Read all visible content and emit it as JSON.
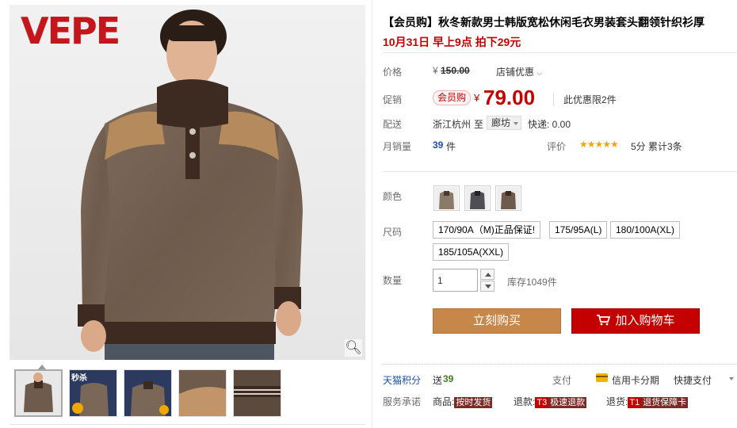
{
  "gallery": {
    "brand_logo": "VEPE",
    "zoom_icon": "magnifier-icon",
    "thumb2_badge": "秒杀"
  },
  "product": {
    "title": "【会员购】秋冬新款男士韩版宽松休闲毛衣男装套头翻领针织衫厚",
    "subtitle": "10月31日 早上9点 拍下29元"
  },
  "price": {
    "label": "价格",
    "currency": "¥",
    "original": "150.00",
    "store_promo": "店铺优惠"
  },
  "promo": {
    "label": "促销",
    "tag": "会员购",
    "currency": "¥",
    "price": "79.00",
    "limit_note": "此优惠限2件"
  },
  "shipping": {
    "label": "配送",
    "from": "浙江杭州",
    "to_word": "至",
    "destination": "廊坊",
    "fee": "快递: 0.00"
  },
  "sales": {
    "label": "月销量",
    "count": "39",
    "unit": "件",
    "review_label": "评价",
    "stars": "★★★★★",
    "score": "5分",
    "total_reviews": "累计3条"
  },
  "colors": {
    "label": "颜色"
  },
  "sizes": {
    "label": "尺码",
    "options": [
      "170/90A（M)正品保证!",
      "175/95A(L)",
      "180/100A(XL)",
      "185/105A(XXL)"
    ]
  },
  "quantity": {
    "label": "数量",
    "value": "1",
    "stock": "库存1049件"
  },
  "actions": {
    "buy_now": "立刻购买",
    "add_to_cart": "加入购物车"
  },
  "points": {
    "label": "天猫积分",
    "gift_prefix": "送",
    "gift_value": "39",
    "pay_label": "支付",
    "credit_installment": "信用卡分期",
    "quick_pay": "快捷支付"
  },
  "service": {
    "label": "服务承诺",
    "goods_prefix": "商品:",
    "goods_tag": "按时发货",
    "refund_prefix": "退款:",
    "refund_code": "T3",
    "refund_tag": "极速退款",
    "return_prefix": "退货:",
    "return_code": "T1",
    "return_tag": "退货保障卡"
  },
  "colors_theme": {
    "price_red": "#c40000",
    "buy_button": "#c8874a",
    "cart_button": "#c40000"
  }
}
